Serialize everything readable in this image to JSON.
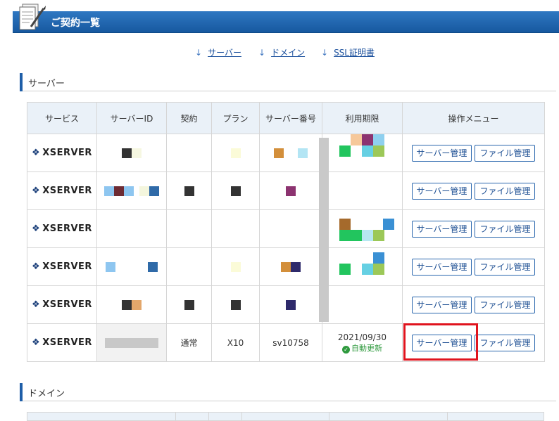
{
  "page": {
    "title": "ご契約一覧"
  },
  "anchors": [
    {
      "label": "サーバー"
    },
    {
      "label": "ドメイン"
    },
    {
      "label": "SSL証明書"
    }
  ],
  "sections": {
    "server": "サーバー",
    "domain": "ドメイン"
  },
  "server_table": {
    "headers": [
      "サービス",
      "サーバーID",
      "契約",
      "プラン",
      "サーバー番号",
      "利用期限",
      "操作メニュー"
    ],
    "rows": [
      {
        "service": "XSERVER",
        "contract": "",
        "plan": "",
        "number": "",
        "expiry": "",
        "status": ""
      },
      {
        "service": "XSERVER",
        "contract": "",
        "plan": "",
        "number": "",
        "expiry": "",
        "status": ""
      },
      {
        "service": "XSERVER",
        "contract": "",
        "plan": "",
        "number": "",
        "expiry": "",
        "status": ""
      },
      {
        "service": "XSERVER",
        "contract": "",
        "plan": "",
        "number": "",
        "expiry": "",
        "status": ""
      },
      {
        "service": "XSERVER",
        "contract": "",
        "plan": "",
        "number": "",
        "expiry": "",
        "status": ""
      },
      {
        "service": "XSERVER",
        "contract": "通常",
        "plan": "X10",
        "number": "sv10758",
        "expiry": "2021/09/30",
        "status": "自動更新"
      }
    ],
    "buttons": {
      "server_manage": "サーバー管理",
      "file_manage": "ファイル管理"
    }
  },
  "colors": {
    "header_blue": "#1e5ea8",
    "highlight_red": "#e0141e",
    "ok_green": "#2f9a3e"
  }
}
